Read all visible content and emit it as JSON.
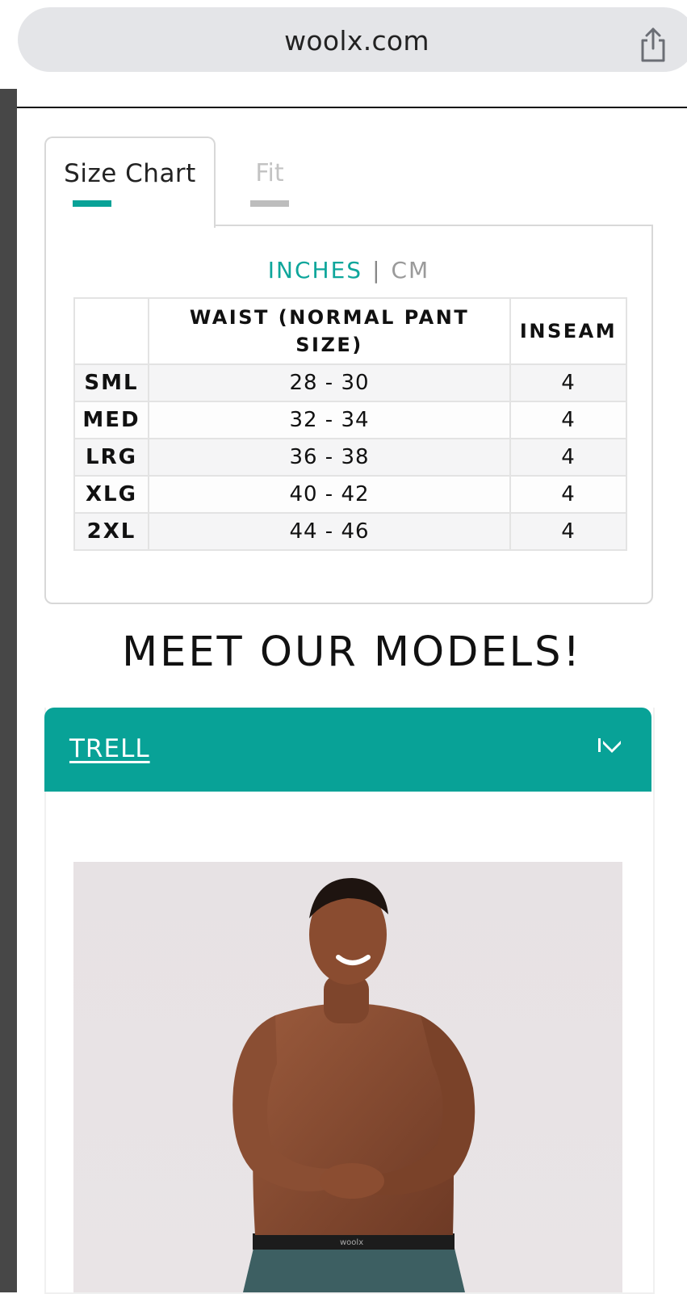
{
  "browser": {
    "url": "woolx.com",
    "share_icon": "share-icon"
  },
  "tabs": [
    {
      "label": "Size Chart",
      "active": true
    },
    {
      "label": "Fit",
      "active": false
    }
  ],
  "units": {
    "inches": "INCHES",
    "separator": "|",
    "cm": "CM",
    "selected": "INCHES"
  },
  "size_table": {
    "headers": [
      "",
      "WAIST (NORMAL PANT SIZE)",
      "INSEAM"
    ],
    "rows": [
      {
        "size": "SML",
        "waist": "28 - 30",
        "inseam": "4"
      },
      {
        "size": "MED",
        "waist": "32 - 34",
        "inseam": "4"
      },
      {
        "size": "LRG",
        "waist": "36 - 38",
        "inseam": "4"
      },
      {
        "size": "XLG",
        "waist": "40 - 42",
        "inseam": "4"
      },
      {
        "size": "2XL",
        "waist": "44 - 46",
        "inseam": "4"
      }
    ]
  },
  "models_section": {
    "heading": "MEET OUR MODELS!",
    "accordion": {
      "title": "TRELL",
      "icon": "chevron-down-icon"
    },
    "waistband_text": "woolx"
  },
  "colors": {
    "accent": "#08a297",
    "strip": "#474747",
    "urlbar": "#e4e5e8"
  }
}
